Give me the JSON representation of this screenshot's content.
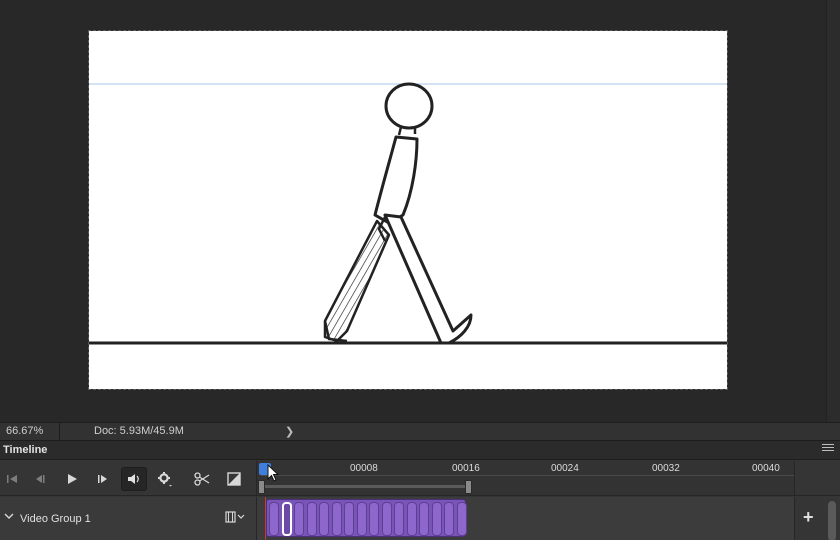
{
  "status": {
    "zoom": "66.67%",
    "doc": "Doc: 5.93M/45.9M",
    "arrow": "❯"
  },
  "panel": {
    "title": "Timeline"
  },
  "controls": [
    {
      "name": "go-to-first-frame-icon"
    },
    {
      "name": "go-to-previous-frame-icon"
    },
    {
      "name": "play-icon"
    },
    {
      "name": "go-to-next-frame-icon"
    },
    {
      "name": "audio-icon"
    },
    {
      "name": "settings-gear-icon"
    },
    {
      "name": "split-scissors-icon"
    },
    {
      "name": "transition-icon"
    }
  ],
  "ruler": {
    "labels": [
      "00008",
      "00016",
      "00024",
      "00032",
      "00040"
    ]
  },
  "track": {
    "name": "Video Group 1",
    "frame_count": 16,
    "selected_frame": 2
  },
  "colors": {
    "clip": "#7a55b8",
    "playhead": "#3f7fdc",
    "background": "#282828"
  }
}
